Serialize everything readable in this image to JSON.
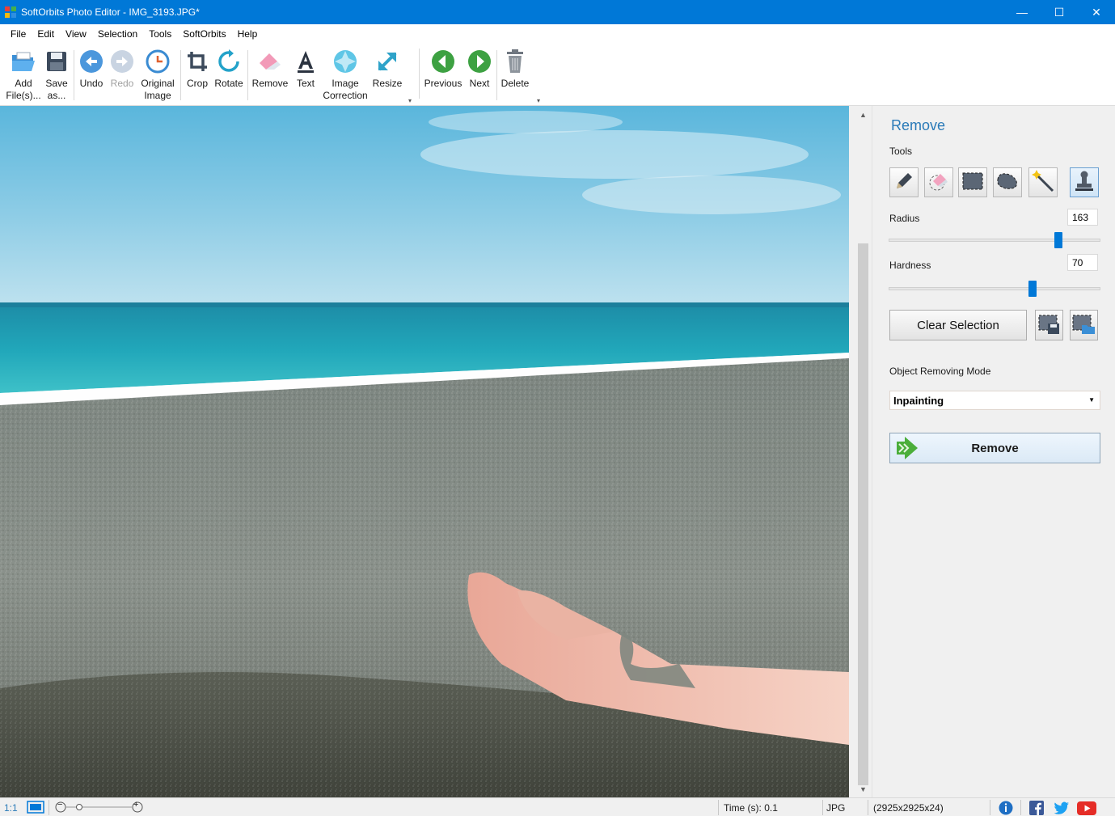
{
  "window": {
    "title": "SoftOrbits Photo Editor - IMG_3193.JPG*",
    "minimize": "—",
    "maximize": "☐",
    "close": "✕"
  },
  "menu": [
    "File",
    "Edit",
    "View",
    "Selection",
    "Tools",
    "SoftOrbits",
    "Help"
  ],
  "toolbar": {
    "add_files": [
      "Add",
      "File(s)..."
    ],
    "save_as": [
      "Save",
      "as..."
    ],
    "undo": "Undo",
    "redo": "Redo",
    "original_image": [
      "Original",
      "Image"
    ],
    "crop": "Crop",
    "rotate": "Rotate",
    "remove": "Remove",
    "text": "Text",
    "image_correction": [
      "Image",
      "Correction"
    ],
    "resize": "Resize",
    "previous": "Previous",
    "next": "Next",
    "delete": "Delete"
  },
  "panel": {
    "title": "Remove",
    "tools_label": "Tools",
    "tools": [
      "pencil-icon",
      "eraser-icon",
      "rect-select-icon",
      "lasso-icon",
      "magic-wand-icon",
      "stamp-icon"
    ],
    "active_tool": "stamp-icon",
    "radius_label": "Radius",
    "radius_value": "163",
    "radius_fraction": 0.8,
    "hardness_label": "Hardness",
    "hardness_value": "70",
    "hardness_fraction": 0.68,
    "clear_selection": "Clear Selection",
    "mode_label": "Object Removing Mode",
    "mode_value": "Inpainting",
    "remove_button": "Remove"
  },
  "status": {
    "zoom_label": "1:1",
    "zoom_minus": "−",
    "zoom_plus": "+",
    "time": "Time (s): 0.1",
    "format": "JPG",
    "dimensions": "(2925x2925x24)"
  },
  "colors": {
    "titlebar": "#0078d7",
    "accent": "#0078d7",
    "panel_title": "#2a7ab8"
  }
}
